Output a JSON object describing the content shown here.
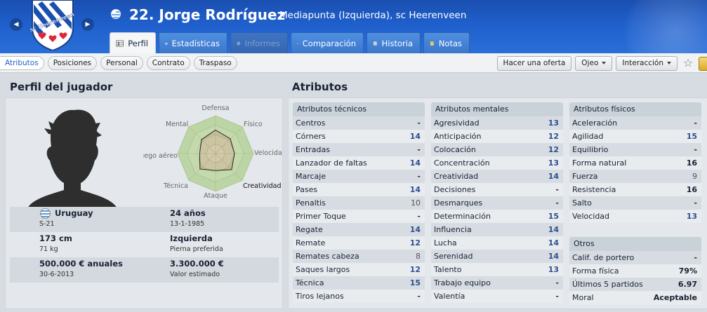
{
  "header": {
    "player_name": "22. Jorge Rodríguez",
    "position_club": "Mediapunta (Izquierda), sc Heerenveen",
    "club_crest_text": "sc Heerenveen",
    "tabs": [
      {
        "label": "Perfil",
        "icon": "profile-icon",
        "active": true
      },
      {
        "label": "Estadísticas",
        "icon": "stats-icon"
      },
      {
        "label": "Informes",
        "icon": "report-icon",
        "disabled": true
      },
      {
        "label": "Comparación",
        "icon": "compare-icon"
      },
      {
        "label": "Historia",
        "icon": "history-icon"
      },
      {
        "label": "Notas",
        "icon": "notes-icon"
      }
    ]
  },
  "toolbar": {
    "subtabs": [
      "Atributos",
      "Posiciones",
      "Personal",
      "Contrato",
      "Traspaso"
    ],
    "make_offer": "Hacer una oferta",
    "scout": "Ojeo",
    "interaction": "Interacción"
  },
  "profile": {
    "title": "Perfil del jugador",
    "radar_labels": {
      "top": "Defensa",
      "top_right": "Físico",
      "right": "Velocidad",
      "bottom_right": "Creatividad",
      "bottom": "Ataque",
      "bottom_left": "Técnica",
      "left": "Juego aéreo",
      "top_left": "Mental"
    },
    "nationality": "Uruguay",
    "national_team": "S-21",
    "age": "24 años",
    "birth_date": "13-1-1985",
    "height": "173 cm",
    "weight": "71 kg",
    "foot": "Izquierda",
    "foot_label": "Pierna preferida",
    "wage": "500.000 € anuales",
    "contract_end": "30-6-2013",
    "value": "3.300.000 €",
    "value_label": "Valor estimado"
  },
  "attributes": {
    "title": "Atributos",
    "technical": {
      "heading": "Atributos técnicos",
      "items": [
        {
          "name": "Centros",
          "value": "-"
        },
        {
          "name": "Córners",
          "value": "14"
        },
        {
          "name": "Entradas",
          "value": "-"
        },
        {
          "name": "Lanzador de faltas",
          "value": "14"
        },
        {
          "name": "Marcaje",
          "value": "-"
        },
        {
          "name": "Pases",
          "value": "14"
        },
        {
          "name": "Penaltis",
          "value": "10"
        },
        {
          "name": "Primer Toque",
          "value": "-"
        },
        {
          "name": "Regate",
          "value": "14"
        },
        {
          "name": "Remate",
          "value": "12"
        },
        {
          "name": "Remates cabeza",
          "value": "8"
        },
        {
          "name": "Saques largos",
          "value": "12"
        },
        {
          "name": "Técnica",
          "value": "15"
        },
        {
          "name": "Tiros lejanos",
          "value": "-"
        }
      ]
    },
    "mental": {
      "heading": "Atributos mentales",
      "items": [
        {
          "name": "Agresividad",
          "value": "13"
        },
        {
          "name": "Anticipación",
          "value": "12"
        },
        {
          "name": "Colocación",
          "value": "12"
        },
        {
          "name": "Concentración",
          "value": "13"
        },
        {
          "name": "Creatividad",
          "value": "14"
        },
        {
          "name": "Decisiones",
          "value": "-"
        },
        {
          "name": "Desmarques",
          "value": "-"
        },
        {
          "name": "Determinación",
          "value": "15"
        },
        {
          "name": "Influencia",
          "value": "14"
        },
        {
          "name": "Lucha",
          "value": "14"
        },
        {
          "name": "Serenidad",
          "value": "14"
        },
        {
          "name": "Talento",
          "value": "13"
        },
        {
          "name": "Trabajo equipo",
          "value": "-"
        },
        {
          "name": "Valentía",
          "value": "-"
        }
      ]
    },
    "physical": {
      "heading": "Atributos físicos",
      "items": [
        {
          "name": "Aceleración",
          "value": "-"
        },
        {
          "name": "Agilidad",
          "value": "15"
        },
        {
          "name": "Equilibrio",
          "value": "-"
        },
        {
          "name": "Forma natural",
          "value": "16"
        },
        {
          "name": "Fuerza",
          "value": "9"
        },
        {
          "name": "Resistencia",
          "value": "16"
        },
        {
          "name": "Salto",
          "value": "-"
        },
        {
          "name": "Velocidad",
          "value": "13"
        }
      ]
    },
    "others": {
      "heading": "Otros",
      "items": [
        {
          "name": "Calif. de portero",
          "value": "-"
        },
        {
          "name": "Forma física",
          "value": "79%"
        },
        {
          "name": "Últimos 5 partidos",
          "value": "6.97"
        },
        {
          "name": "Moral",
          "value": "Aceptable"
        }
      ]
    }
  }
}
